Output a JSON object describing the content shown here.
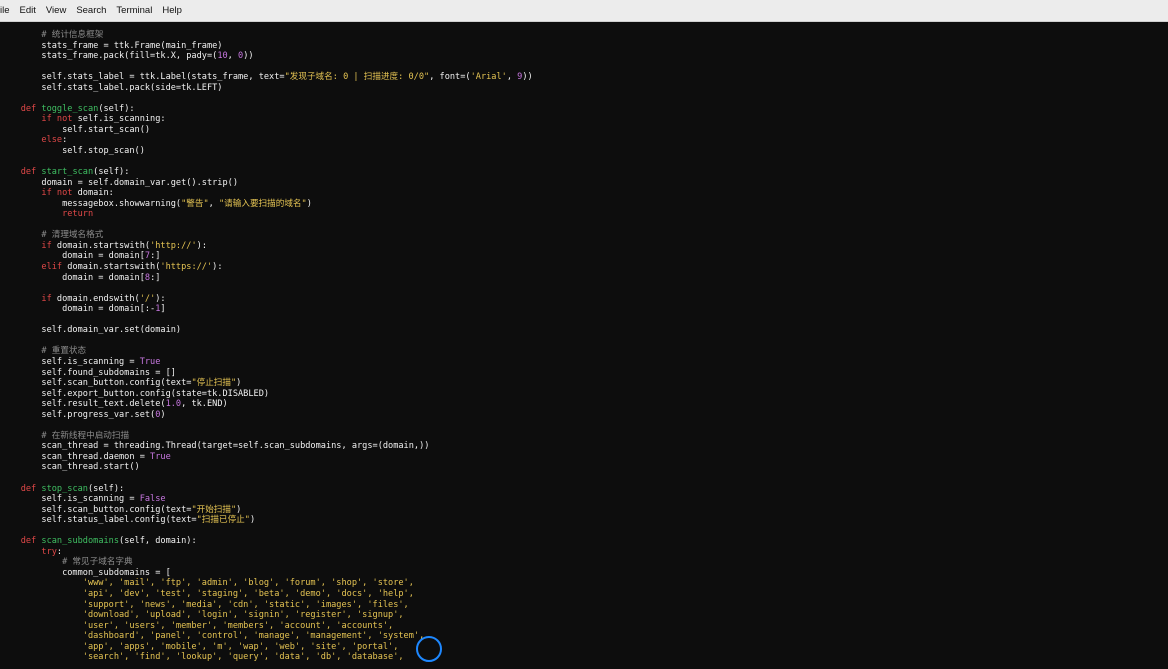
{
  "menubar": {
    "items": [
      "ile",
      "Edit",
      "View",
      "Search",
      "Terminal",
      "Help"
    ]
  },
  "editor": {
    "lines": [
      [
        [
          "cm",
          "        # 统计信息框架"
        ]
      ],
      [
        [
          "t",
          "        stats_frame = ttk.Frame(main_frame)"
        ]
      ],
      [
        [
          "t",
          "        stats_frame.pack(fill=tk.X, pady=("
        ],
        [
          "num",
          "10"
        ],
        [
          "t",
          ", "
        ],
        [
          "num",
          "0"
        ],
        [
          "t",
          "))"
        ]
      ],
      [
        [
          "t",
          ""
        ]
      ],
      [
        [
          "t",
          "        self.stats_label = ttk.Label(stats_frame, text="
        ],
        [
          "str",
          "\"发现子域名: 0 | 扫描进度: 0/0\""
        ],
        [
          "t",
          ", font=("
        ],
        [
          "str",
          "'Arial'"
        ],
        [
          "t",
          ", "
        ],
        [
          "num",
          "9"
        ],
        [
          "t",
          "))"
        ]
      ],
      [
        [
          "t",
          "        self.stats_label.pack(side=tk.LEFT)"
        ]
      ],
      [
        [
          "t",
          ""
        ]
      ],
      [
        [
          "kw",
          "    def "
        ],
        [
          "fn",
          "toggle_scan"
        ],
        [
          "t",
          "(self):"
        ]
      ],
      [
        [
          "kw",
          "        if not "
        ],
        [
          "t",
          "self.is_scanning:"
        ]
      ],
      [
        [
          "t",
          "            self.start_scan()"
        ]
      ],
      [
        [
          "kw",
          "        else"
        ],
        [
          "t",
          ":"
        ]
      ],
      [
        [
          "t",
          "            self.stop_scan()"
        ]
      ],
      [
        [
          "t",
          ""
        ]
      ],
      [
        [
          "kw",
          "    def "
        ],
        [
          "fn",
          "start_scan"
        ],
        [
          "t",
          "(self):"
        ]
      ],
      [
        [
          "t",
          "        domain = self.domain_var.get().strip()"
        ]
      ],
      [
        [
          "kw",
          "        if not "
        ],
        [
          "t",
          "domain:"
        ]
      ],
      [
        [
          "t",
          "            messagebox.showwarning("
        ],
        [
          "str",
          "\"警告\""
        ],
        [
          "t",
          ", "
        ],
        [
          "str",
          "\"请输入要扫描的域名\""
        ],
        [
          "t",
          ")"
        ]
      ],
      [
        [
          "kw",
          "            return"
        ]
      ],
      [
        [
          "t",
          ""
        ]
      ],
      [
        [
          "cm",
          "        # 清理域名格式"
        ]
      ],
      [
        [
          "kw",
          "        if "
        ],
        [
          "t",
          "domain.startswith("
        ],
        [
          "str",
          "'http://'"
        ],
        [
          "t",
          "):"
        ]
      ],
      [
        [
          "t",
          "            domain = domain["
        ],
        [
          "num",
          "7"
        ],
        [
          "t",
          ":]"
        ]
      ],
      [
        [
          "kw",
          "        elif "
        ],
        [
          "t",
          "domain.startswith("
        ],
        [
          "str",
          "'https://'"
        ],
        [
          "t",
          "):"
        ]
      ],
      [
        [
          "t",
          "            domain = domain["
        ],
        [
          "num",
          "8"
        ],
        [
          "t",
          ":]"
        ]
      ],
      [
        [
          "t",
          ""
        ]
      ],
      [
        [
          "kw",
          "        if "
        ],
        [
          "t",
          "domain.endswith("
        ],
        [
          "str",
          "'/'"
        ],
        [
          "t",
          "):"
        ]
      ],
      [
        [
          "t",
          "            domain = domain[:-"
        ],
        [
          "num",
          "1"
        ],
        [
          "t",
          "]"
        ]
      ],
      [
        [
          "t",
          ""
        ]
      ],
      [
        [
          "t",
          "        self.domain_var.set(domain)"
        ]
      ],
      [
        [
          "t",
          ""
        ]
      ],
      [
        [
          "cm",
          "        # 重置状态"
        ]
      ],
      [
        [
          "t",
          "        self.is_scanning = "
        ],
        [
          "const",
          "True"
        ]
      ],
      [
        [
          "t",
          "        self.found_subdomains = []"
        ]
      ],
      [
        [
          "t",
          "        self.scan_button.config(text="
        ],
        [
          "str",
          "\"停止扫描\""
        ],
        [
          "t",
          ")"
        ]
      ],
      [
        [
          "t",
          "        self.export_button.config(state=tk.DISABLED)"
        ]
      ],
      [
        [
          "t",
          "        self.result_text.delete("
        ],
        [
          "num",
          "1.0"
        ],
        [
          "t",
          ", tk.END)"
        ]
      ],
      [
        [
          "t",
          "        self.progress_var.set("
        ],
        [
          "num",
          "0"
        ],
        [
          "t",
          ")"
        ]
      ],
      [
        [
          "t",
          ""
        ]
      ],
      [
        [
          "cm",
          "        # 在新线程中启动扫描"
        ]
      ],
      [
        [
          "t",
          "        scan_thread = threading.Thread(target=self.scan_subdomains, args=(domain,))"
        ]
      ],
      [
        [
          "t",
          "        scan_thread.daemon = "
        ],
        [
          "const",
          "True"
        ]
      ],
      [
        [
          "t",
          "        scan_thread.start()"
        ]
      ],
      [
        [
          "t",
          ""
        ]
      ],
      [
        [
          "kw",
          "    def "
        ],
        [
          "fn",
          "stop_scan"
        ],
        [
          "t",
          "(self):"
        ]
      ],
      [
        [
          "t",
          "        self.is_scanning = "
        ],
        [
          "const",
          "False"
        ]
      ],
      [
        [
          "t",
          "        self.scan_button.config(text="
        ],
        [
          "str",
          "\"开始扫描\""
        ],
        [
          "t",
          ")"
        ]
      ],
      [
        [
          "t",
          "        self.status_label.config(text="
        ],
        [
          "str",
          "\"扫描已停止\""
        ],
        [
          "t",
          ")"
        ]
      ],
      [
        [
          "t",
          ""
        ]
      ],
      [
        [
          "kw",
          "    def "
        ],
        [
          "fn",
          "scan_subdomains"
        ],
        [
          "t",
          "(self, domain):"
        ]
      ],
      [
        [
          "kw",
          "        try"
        ],
        [
          "t",
          ":"
        ]
      ],
      [
        [
          "cm",
          "            # 常见子域名字典"
        ]
      ],
      [
        [
          "t",
          "            common_subdomains = ["
        ]
      ],
      [
        [
          "str",
          "                'www', 'mail', 'ftp', 'admin', 'blog', 'forum', 'shop', 'store',"
        ]
      ],
      [
        [
          "str",
          "                'api', 'dev', 'test', 'staging', 'beta', 'demo', 'docs', 'help',"
        ]
      ],
      [
        [
          "str",
          "                'support', 'news', 'media', 'cdn', 'static', 'images', 'files',"
        ]
      ],
      [
        [
          "str",
          "                'download', 'upload', 'login', 'signin', 'register', 'signup',"
        ]
      ],
      [
        [
          "str",
          "                'user', 'users', 'member', 'members', 'account', 'accounts',"
        ]
      ],
      [
        [
          "str",
          "                'dashboard', 'panel', 'control', 'manage', 'management', 'system',"
        ]
      ],
      [
        [
          "str",
          "                'app', 'apps', 'mobile', 'm', 'wap', 'web', 'site', 'portal',"
        ]
      ],
      [
        [
          "str",
          "                'search', 'find', 'lookup', 'query', 'data', 'db', 'database',"
        ]
      ]
    ]
  }
}
